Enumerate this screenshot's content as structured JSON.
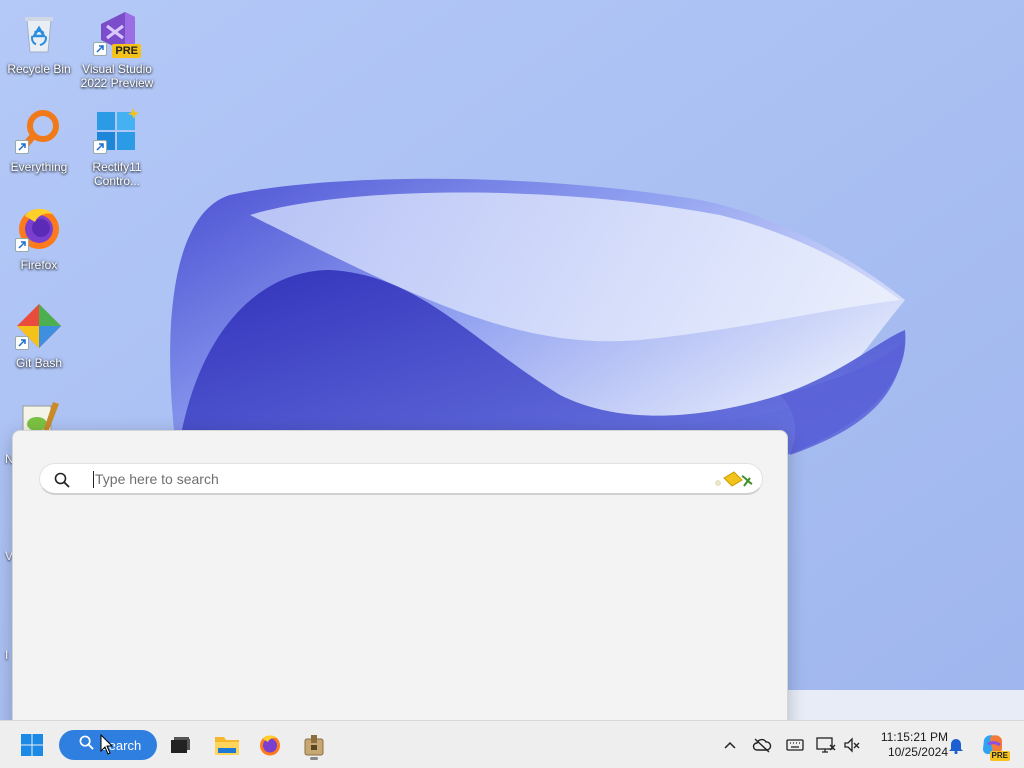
{
  "desktop": {
    "icons": [
      {
        "label": "Recycle Bin",
        "icon": "recycle-bin-icon"
      },
      {
        "label": "Visual Studio 2022 Preview",
        "icon": "visual-studio-icon",
        "badge": "PRE"
      },
      {
        "label": "Everything",
        "icon": "everything-search-icon"
      },
      {
        "label": "Rectify11 Contro...",
        "icon": "rectify11-icon"
      },
      {
        "label": "Firefox",
        "icon": "firefox-icon"
      },
      {
        "label": "Git Bash",
        "icon": "git-bash-icon"
      }
    ],
    "partial_labels": [
      "N",
      "V",
      "I"
    ]
  },
  "search": {
    "placeholder": "Type here to search",
    "value": ""
  },
  "taskbar": {
    "search_label": "Search",
    "pinned": [
      "start-icon",
      "search-icon",
      "task-view-icon",
      "file-explorer-icon",
      "firefox-icon",
      "package-icon"
    ],
    "tray": [
      "chevron-up-icon",
      "cloud-off-icon",
      "keyboard-icon",
      "display-icon",
      "volume-muted-icon"
    ],
    "clock": {
      "time": "11:15:21 PM",
      "date": "10/25/2024"
    },
    "copilot_badge": "PRE"
  },
  "colors": {
    "accent": "#2f7fe0",
    "desktop_bg": "#a9bff2",
    "panel_bg": "#f3f3f3",
    "taskbar_bg": "#eeeeee"
  }
}
